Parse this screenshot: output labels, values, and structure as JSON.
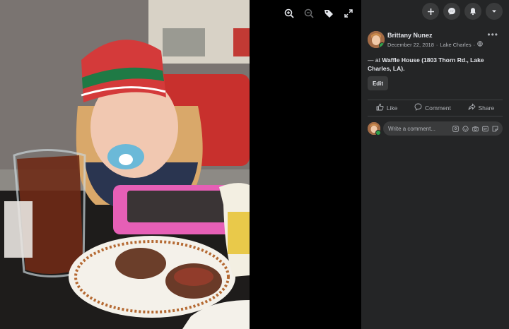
{
  "post": {
    "author": "Brittany Nunez",
    "date": "December 22, 2018",
    "location": "Lake Charles",
    "separator": "·",
    "text_prefix": "— at ",
    "place": "Waffle House (1803 Thorn Rd., Lake Charles, LA).",
    "edit_label": "Edit"
  },
  "actions": {
    "like": "Like",
    "comment": "Comment",
    "share": "Share"
  },
  "comment_box": {
    "placeholder": "Write a comment..."
  },
  "top_bar": {
    "icons": [
      "plus-icon",
      "messenger-icon",
      "notifications-icon",
      "account-menu-icon"
    ]
  },
  "viewer_tools": {
    "icons": [
      "zoom-in-icon",
      "zoom-out-icon",
      "tag-icon",
      "fullscreen-icon"
    ]
  },
  "colors": {
    "panel_bg": "#242526",
    "page_bg": "#18191a",
    "button_bg": "#3a3b3c",
    "text_primary": "#e4e6eb",
    "text_secondary": "#b0b3b8",
    "online": "#31a24c"
  }
}
